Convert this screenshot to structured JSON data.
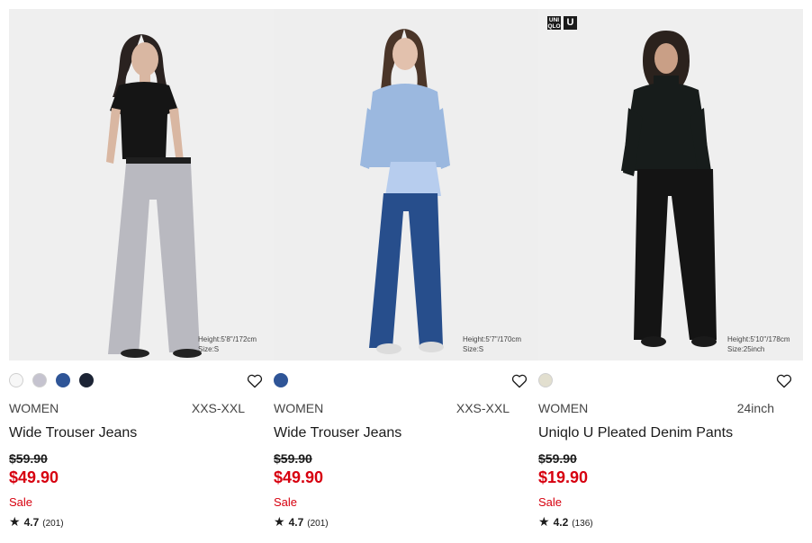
{
  "products": [
    {
      "photo_caption_height": "Height:5'8''/172cm",
      "photo_caption_size": "Size:S",
      "swatches": [
        "#f7f7f7",
        "#c5c3cf",
        "#2f5597",
        "#1c2435"
      ],
      "gender": "WOMEN",
      "size_range": "XXS-XXL",
      "name": "Wide Trouser Jeans",
      "original_price": "$59.90",
      "sale_price": "$49.90",
      "flag": "Sale",
      "rating": "4.7",
      "review_count": "(201)"
    },
    {
      "photo_caption_height": "Height:5'7''/170cm",
      "photo_caption_size": "Size:S",
      "swatches": [
        "#2f5597"
      ],
      "gender": "WOMEN",
      "size_range": "XXS-XXL",
      "name": "Wide Trouser Jeans",
      "original_price": "$59.90",
      "sale_price": "$49.90",
      "flag": "Sale",
      "rating": "4.7",
      "review_count": "(201)"
    },
    {
      "brand_logo": "UNI QLO",
      "brand_logo_u": "U",
      "photo_caption_height": "Height:5'10''/178cm",
      "photo_caption_size": "Size:25inch",
      "swatches": [
        "#e2dfcf"
      ],
      "gender": "WOMEN",
      "size_range": "24inch",
      "name": "Uniqlo U Pleated Denim Pants",
      "original_price": "$59.90",
      "sale_price": "$19.90",
      "flag": "Sale",
      "rating": "4.2",
      "review_count": "(136)"
    }
  ],
  "icons": {
    "wishlist": "heart-icon",
    "rating": "star-icon"
  },
  "colors": {
    "sale": "#d7000f",
    "text": "#1b1b1b"
  }
}
